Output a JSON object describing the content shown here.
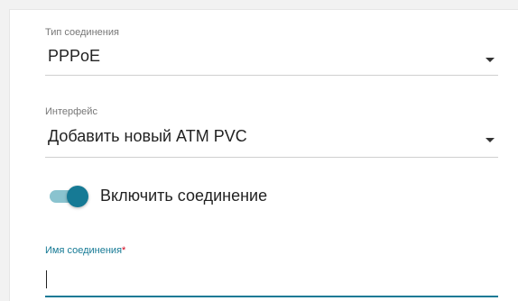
{
  "connection_type": {
    "label": "Тип соединения",
    "value": "PPPoE"
  },
  "interface": {
    "label": "Интерфейс",
    "value": "Добавить новый ATM PVC"
  },
  "enable_connection": {
    "label": "Включить соединение",
    "checked": true
  },
  "connection_name": {
    "label": "Имя соединения",
    "required_mark": "*",
    "value": "",
    "placeholder": ""
  },
  "colors": {
    "accent": "#167a95",
    "toggle_track": "#8ac3cf",
    "required": "#d0021b"
  },
  "icons": {
    "dropdown": "chevron-down-icon"
  }
}
